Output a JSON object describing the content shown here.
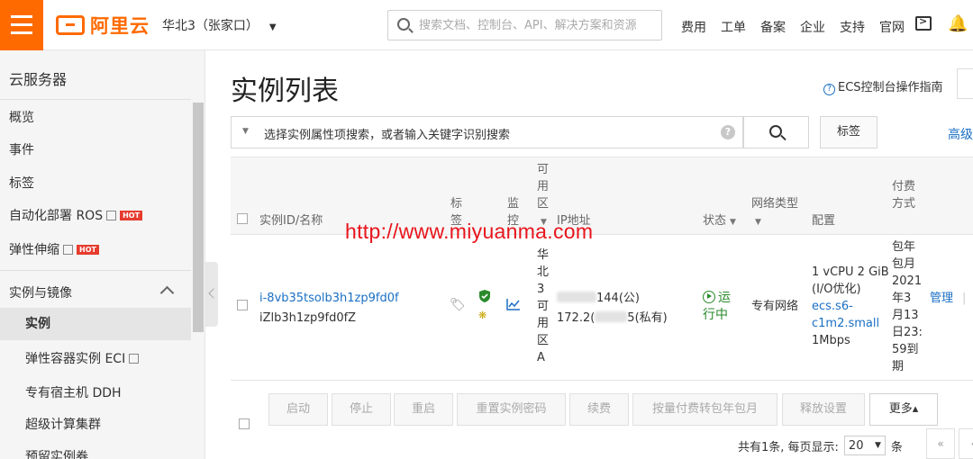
{
  "header": {
    "logo_text": "阿里云",
    "region": "华北3（张家口）",
    "search_placeholder": "搜索文档、控制台、API、解决方案和资源",
    "nav": [
      "费用",
      "工单",
      "备案",
      "企业",
      "支持",
      "官网"
    ],
    "accent_color": "#ff6a00"
  },
  "sidebar": {
    "title": "云服务器",
    "items": [
      {
        "label": "概览"
      },
      {
        "label": "事件"
      },
      {
        "label": "标签"
      },
      {
        "label": "自动化部署 ROS",
        "external": true,
        "hot": "HOT"
      },
      {
        "label": "弹性伸缩",
        "external": true,
        "hot": "HOT"
      }
    ],
    "section": "实例与镜像",
    "sub_items": [
      {
        "label": "实例",
        "active": true
      },
      {
        "label": "弹性容器实例 ECI",
        "external": true
      },
      {
        "label": "专有宿主机 DDH"
      },
      {
        "label": "超级计算集群"
      },
      {
        "label": "预留实例券"
      }
    ]
  },
  "main": {
    "title": "实例列表",
    "guide": "ECS控制台操作指南",
    "filter_placeholder": "选择实例属性项搜索，或者输入关键字识别搜索",
    "help_mark": "?",
    "tag_button": "标签",
    "advanced": "高级",
    "columns": {
      "id_name": "实例ID/名称",
      "tag": "标签",
      "monitor": "监控",
      "zone": "可用区",
      "ip": "IP地址",
      "status": "状态",
      "network": "网络类型",
      "config": "配置",
      "billing": "付费方式"
    },
    "row": {
      "id": "i-8vb35tsolb3h1zp9fd0f",
      "name": "iZlb3h1zp9fd0fZ",
      "zone": "华北3可用区A",
      "ip_public_suffix": "144(公)",
      "ip_private_prefix": "172.2(",
      "ip_private_suffix": "5(私有)",
      "status": "运行中",
      "network": "专有网络",
      "config_line1": "1 vCPU 2 GiB",
      "config_line2": "(I/O优化)",
      "instance_type": "ecs.s6-c1m2.small",
      "bandwidth": "1Mbps",
      "billing": "包年包月",
      "expiry": "2021年3月13日23:59到期",
      "manage": "管理",
      "separator": "|"
    },
    "action_buttons": [
      "启动",
      "停止",
      "重启",
      "重置实例密码",
      "续费",
      "按量付费转包年包月",
      "释放设置"
    ],
    "more_button": "更多▴",
    "pager": {
      "total_text": "共有1条, 每页显示:",
      "page_size": "20",
      "unit": "条",
      "first": "«",
      "prev": "‹"
    },
    "status_color": "#2a8a2a",
    "link_color": "#1a6fc4"
  },
  "watermark": "http://www.miyuanma.com"
}
